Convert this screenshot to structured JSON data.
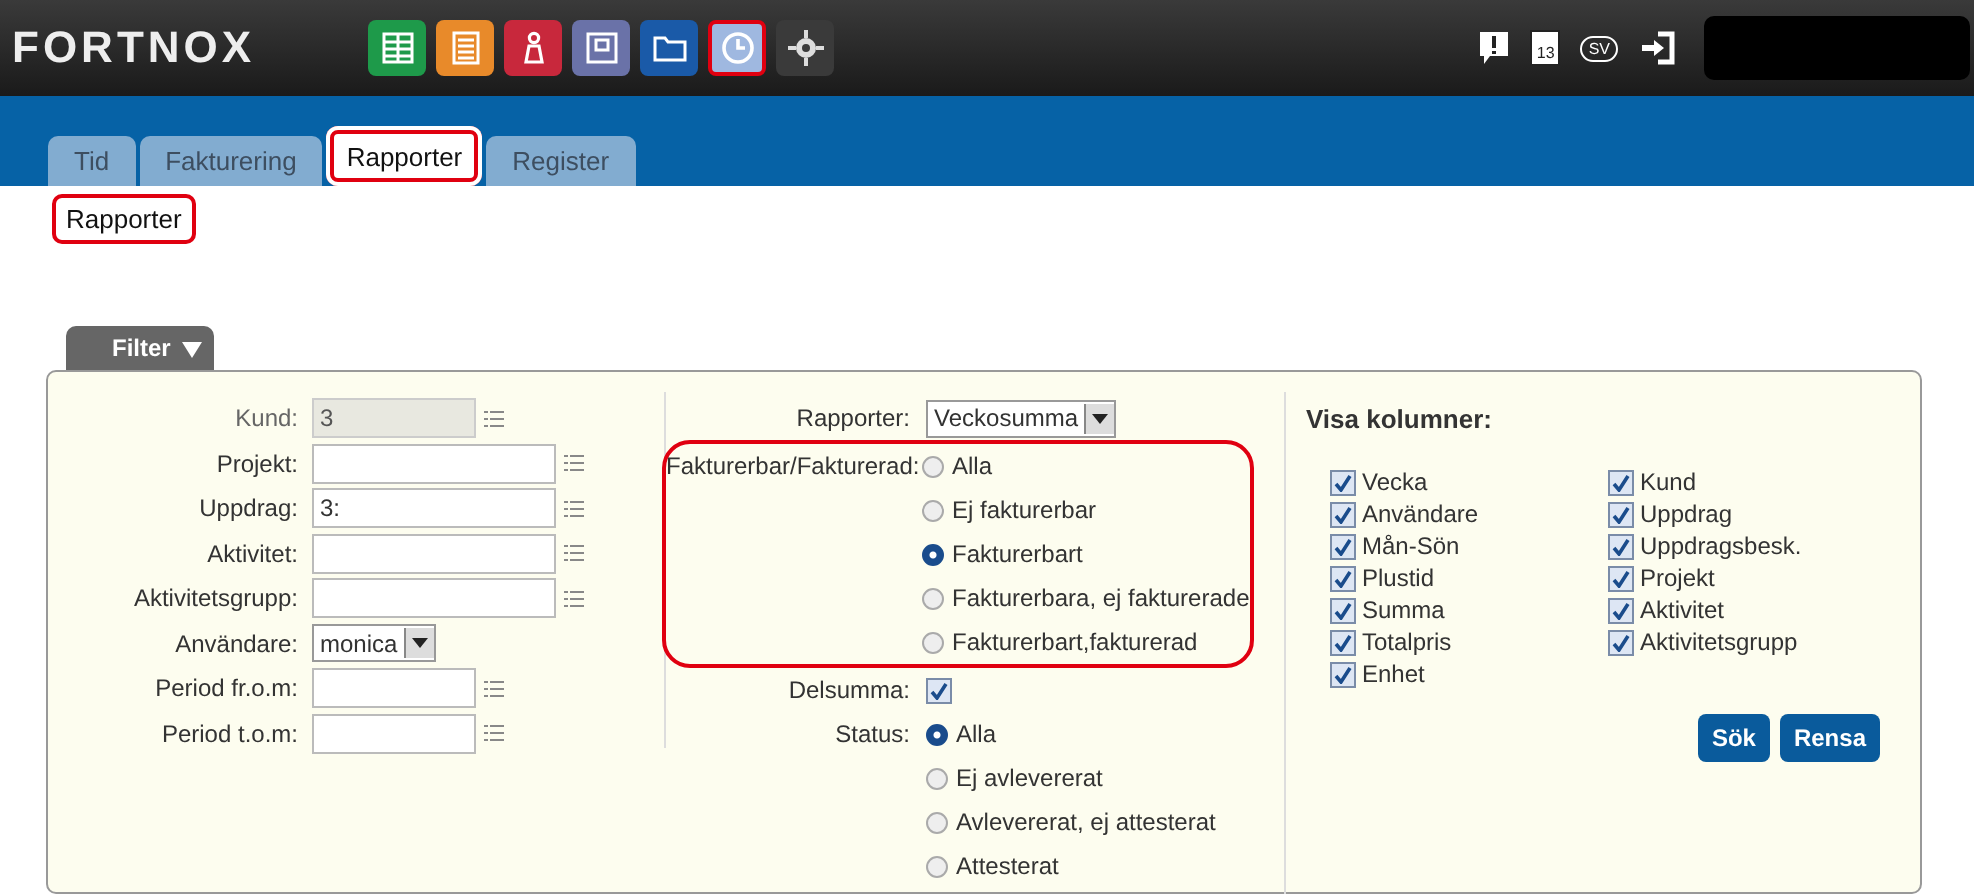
{
  "header": {
    "logo": "FORTNOX",
    "apps": [
      {
        "kind": "sheet",
        "selected": false,
        "highlighted": false
      },
      {
        "kind": "document",
        "selected": false,
        "highlighted": false
      },
      {
        "kind": "person",
        "selected": false,
        "highlighted": false
      },
      {
        "kind": "window",
        "selected": false,
        "highlighted": false
      },
      {
        "kind": "folder",
        "selected": false,
        "highlighted": false
      },
      {
        "kind": "clock",
        "selected": true,
        "highlighted": true
      },
      {
        "kind": "gear",
        "selected": false,
        "highlighted": false
      }
    ],
    "tray": [
      {
        "kind": "alert"
      },
      {
        "kind": "calendar",
        "text": "13"
      },
      {
        "kind": "language",
        "text": "SV"
      },
      {
        "kind": "logout"
      }
    ]
  },
  "tabs": [
    {
      "label": "Tid",
      "selected": false,
      "highlighted": false
    },
    {
      "label": "Fakturering",
      "selected": false,
      "highlighted": false
    },
    {
      "label": "Rapporter",
      "selected": true,
      "highlighted": true
    },
    {
      "label": "Register",
      "selected": false,
      "highlighted": false
    }
  ],
  "breadcrumb": {
    "text": "Rapporter",
    "highlighted": true
  },
  "filter": {
    "label": "Filter",
    "expanded": true,
    "fields": [
      {
        "label": "Kund:",
        "kind": "text",
        "value": "3",
        "disabled": true
      },
      {
        "label": "Projekt:",
        "kind": "text",
        "disabled": false
      },
      {
        "label": "Uppdrag:",
        "kind": "text",
        "value": "3:",
        "disabled": false
      },
      {
        "label": "Aktivitet:",
        "kind": "text",
        "disabled": false
      },
      {
        "label": "Aktivitetsgrupp:",
        "kind": "text",
        "disabled": false
      },
      {
        "label": "Användare:",
        "kind": "select",
        "value": "monica",
        "disabled": false
      },
      {
        "label": "Period fr.o.m:",
        "kind": "date",
        "disabled": false
      },
      {
        "label": "Period t.o.m:",
        "kind": "date",
        "disabled": false
      }
    ],
    "report": {
      "label": "Rapporter:",
      "value": "Veckosumma"
    },
    "invoicing": {
      "label": "Fakturerbar/Fakturerad:",
      "highlighted": true,
      "options": [
        {
          "label": "Alla",
          "selected": false
        },
        {
          "label": "Ej fakturerbar",
          "selected": false
        },
        {
          "label": "Fakturerbart",
          "selected": true
        },
        {
          "label": "Fakturerbara, ej fakturerade",
          "selected": false
        },
        {
          "label": "Fakturerbart,fakturerad",
          "selected": false
        }
      ]
    },
    "subtotal": {
      "label": "Delsumma:",
      "checked": true
    },
    "status": {
      "label": "Status:",
      "options": [
        {
          "label": "Alla",
          "selected": true
        },
        {
          "label": "Ej avlevererat",
          "selected": false
        },
        {
          "label": "Avlevererat, ej attesterat",
          "selected": false
        },
        {
          "label": "Attesterat",
          "selected": false
        }
      ]
    },
    "columns": {
      "title": "Visa kolumner:",
      "groups": [
        [
          {
            "label": "Vecka",
            "checked": true
          },
          {
            "label": "Användare",
            "checked": true
          },
          {
            "label": "Mån-Sön",
            "checked": true
          },
          {
            "label": "Plustid",
            "checked": true
          },
          {
            "label": "Summa",
            "checked": true
          },
          {
            "label": "Totalpris",
            "checked": true
          },
          {
            "label": "Enhet",
            "checked": true
          }
        ],
        [
          {
            "label": "Kund",
            "checked": true
          },
          {
            "label": "Uppdrag",
            "checked": true
          },
          {
            "label": "Uppdragsbesk.",
            "checked": true
          },
          {
            "label": "Projekt",
            "checked": true
          },
          {
            "label": "Aktivitet",
            "checked": true
          },
          {
            "label": "Aktivitetsgrupp",
            "checked": true
          }
        ]
      ]
    },
    "buttons": [
      {
        "label": "Sök"
      },
      {
        "label": "Rensa"
      }
    ]
  }
}
